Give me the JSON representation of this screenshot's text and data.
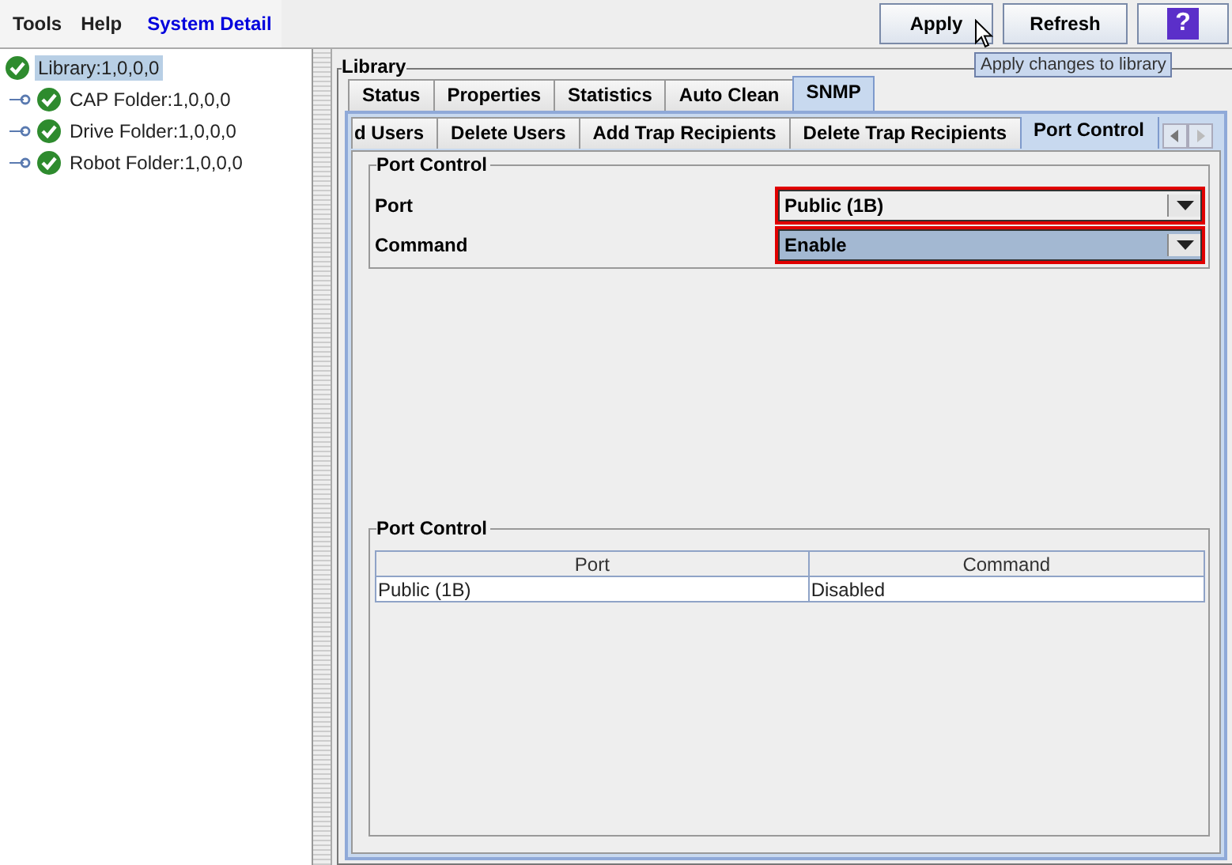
{
  "menu": [
    {
      "label": "Tools",
      "kind": "menu"
    },
    {
      "label": "Help",
      "kind": "menu"
    },
    {
      "label": "System Detail",
      "kind": "link"
    }
  ],
  "toolbar": [
    {
      "label": "Apply",
      "kind": "text"
    },
    {
      "label": "Refresh",
      "kind": "text"
    },
    {
      "label": "?",
      "kind": "help"
    }
  ],
  "tooltip": "Apply changes to library",
  "tree": [
    {
      "label": "Library:1,0,0,0",
      "selected": true,
      "children": [
        {
          "label": "CAP Folder:1,0,0,0",
          "selected": false
        },
        {
          "label": "Drive Folder:1,0,0,0",
          "selected": false
        },
        {
          "label": "Robot Folder:1,0,0,0",
          "selected": false
        }
      ]
    }
  ],
  "library": {
    "title": "Library",
    "tabs": [
      {
        "label": "Status",
        "selected": false
      },
      {
        "label": "Properties",
        "selected": false
      },
      {
        "label": "Statistics",
        "selected": false
      },
      {
        "label": "Auto Clean",
        "selected": false
      },
      {
        "label": "SNMP",
        "selected": true
      }
    ],
    "subtabs": [
      {
        "label": "d Users",
        "selected": false
      },
      {
        "label": "Delete Users",
        "selected": false
      },
      {
        "label": "Add Trap Recipients",
        "selected": false
      },
      {
        "label": "Delete Trap Recipients",
        "selected": false
      },
      {
        "label": "Port Control",
        "selected": true
      }
    ],
    "form": {
      "title": "Port Control",
      "fields": [
        {
          "label": "Port",
          "value": "Public (1B)",
          "highlighted": false
        },
        {
          "label": "Command",
          "value": "Enable",
          "highlighted": true
        }
      ]
    },
    "table": {
      "title": "Port Control",
      "columns": [
        "Port",
        "Command"
      ],
      "rows": [
        [
          "Public (1B)",
          "Disabled"
        ]
      ]
    }
  }
}
